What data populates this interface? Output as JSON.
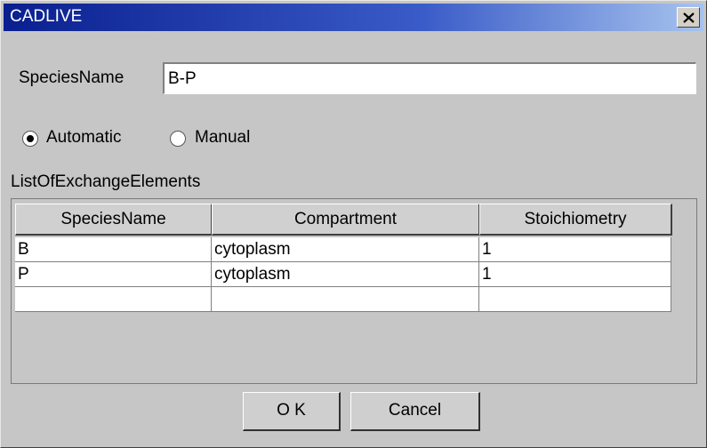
{
  "window": {
    "title": "CADLIVE"
  },
  "species_name": {
    "label": "SpeciesName",
    "value": "B-P"
  },
  "mode": {
    "options": [
      {
        "label": "Automatic",
        "selected": true
      },
      {
        "label": "Manual",
        "selected": false
      }
    ]
  },
  "exchange_list": {
    "label": "ListOfExchangeElements",
    "columns": [
      "SpeciesName",
      "Compartment",
      "Stoichiometry"
    ],
    "rows": [
      [
        "B",
        "cytoplasm",
        "1"
      ],
      [
        "P",
        "cytoplasm",
        "1"
      ],
      [
        "",
        "",
        ""
      ]
    ]
  },
  "buttons": {
    "ok": "O K",
    "cancel": "Cancel"
  }
}
